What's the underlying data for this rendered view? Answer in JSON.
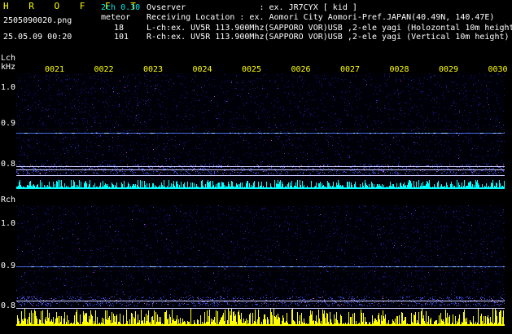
{
  "header": {
    "title": "H R O F F T",
    "mode": "2ch 0.30",
    "filename": "2505090020.png",
    "timestamp": "25.05.09 00:20",
    "meteor_label": "meteor",
    "count_l": "18",
    "count_r": "101",
    "observer": "Ovserver               : ex. JR7CYX [ kid ]",
    "location": "Receiving Location : ex. Aomori City Aomori-Pref.JAPAN(40.49N, 140.47E)",
    "lch_info": "L-ch:ex. UV5R 113.900Mhz(SAPPORO VOR)USB ,2-ele yagi (Holozontal 10m height)",
    "rch_info": "R-ch:ex. UV5R 113.900Mhz(SAPPORO VOR)USB ,2-ele yagi (Vertical 10m height)"
  },
  "lch": {
    "label": "Lch",
    "unit": "kHz",
    "ticks": [
      "1.0",
      "0.9",
      "0.8"
    ]
  },
  "rch": {
    "label": "Rch",
    "ticks": [
      "1.0",
      "0.9",
      "0.8"
    ]
  },
  "time_ticks": [
    "0021",
    "0022",
    "0023",
    "0024",
    "0025",
    "0026",
    "0027",
    "0028",
    "0029",
    "0030"
  ],
  "colors": {
    "background": "#000000",
    "noise": "#1a1a8c",
    "signal": "#6aa8ff",
    "lch_bars": "#00ffff",
    "rch_bars": "#ffff00",
    "ticks": "#ffff00"
  }
}
